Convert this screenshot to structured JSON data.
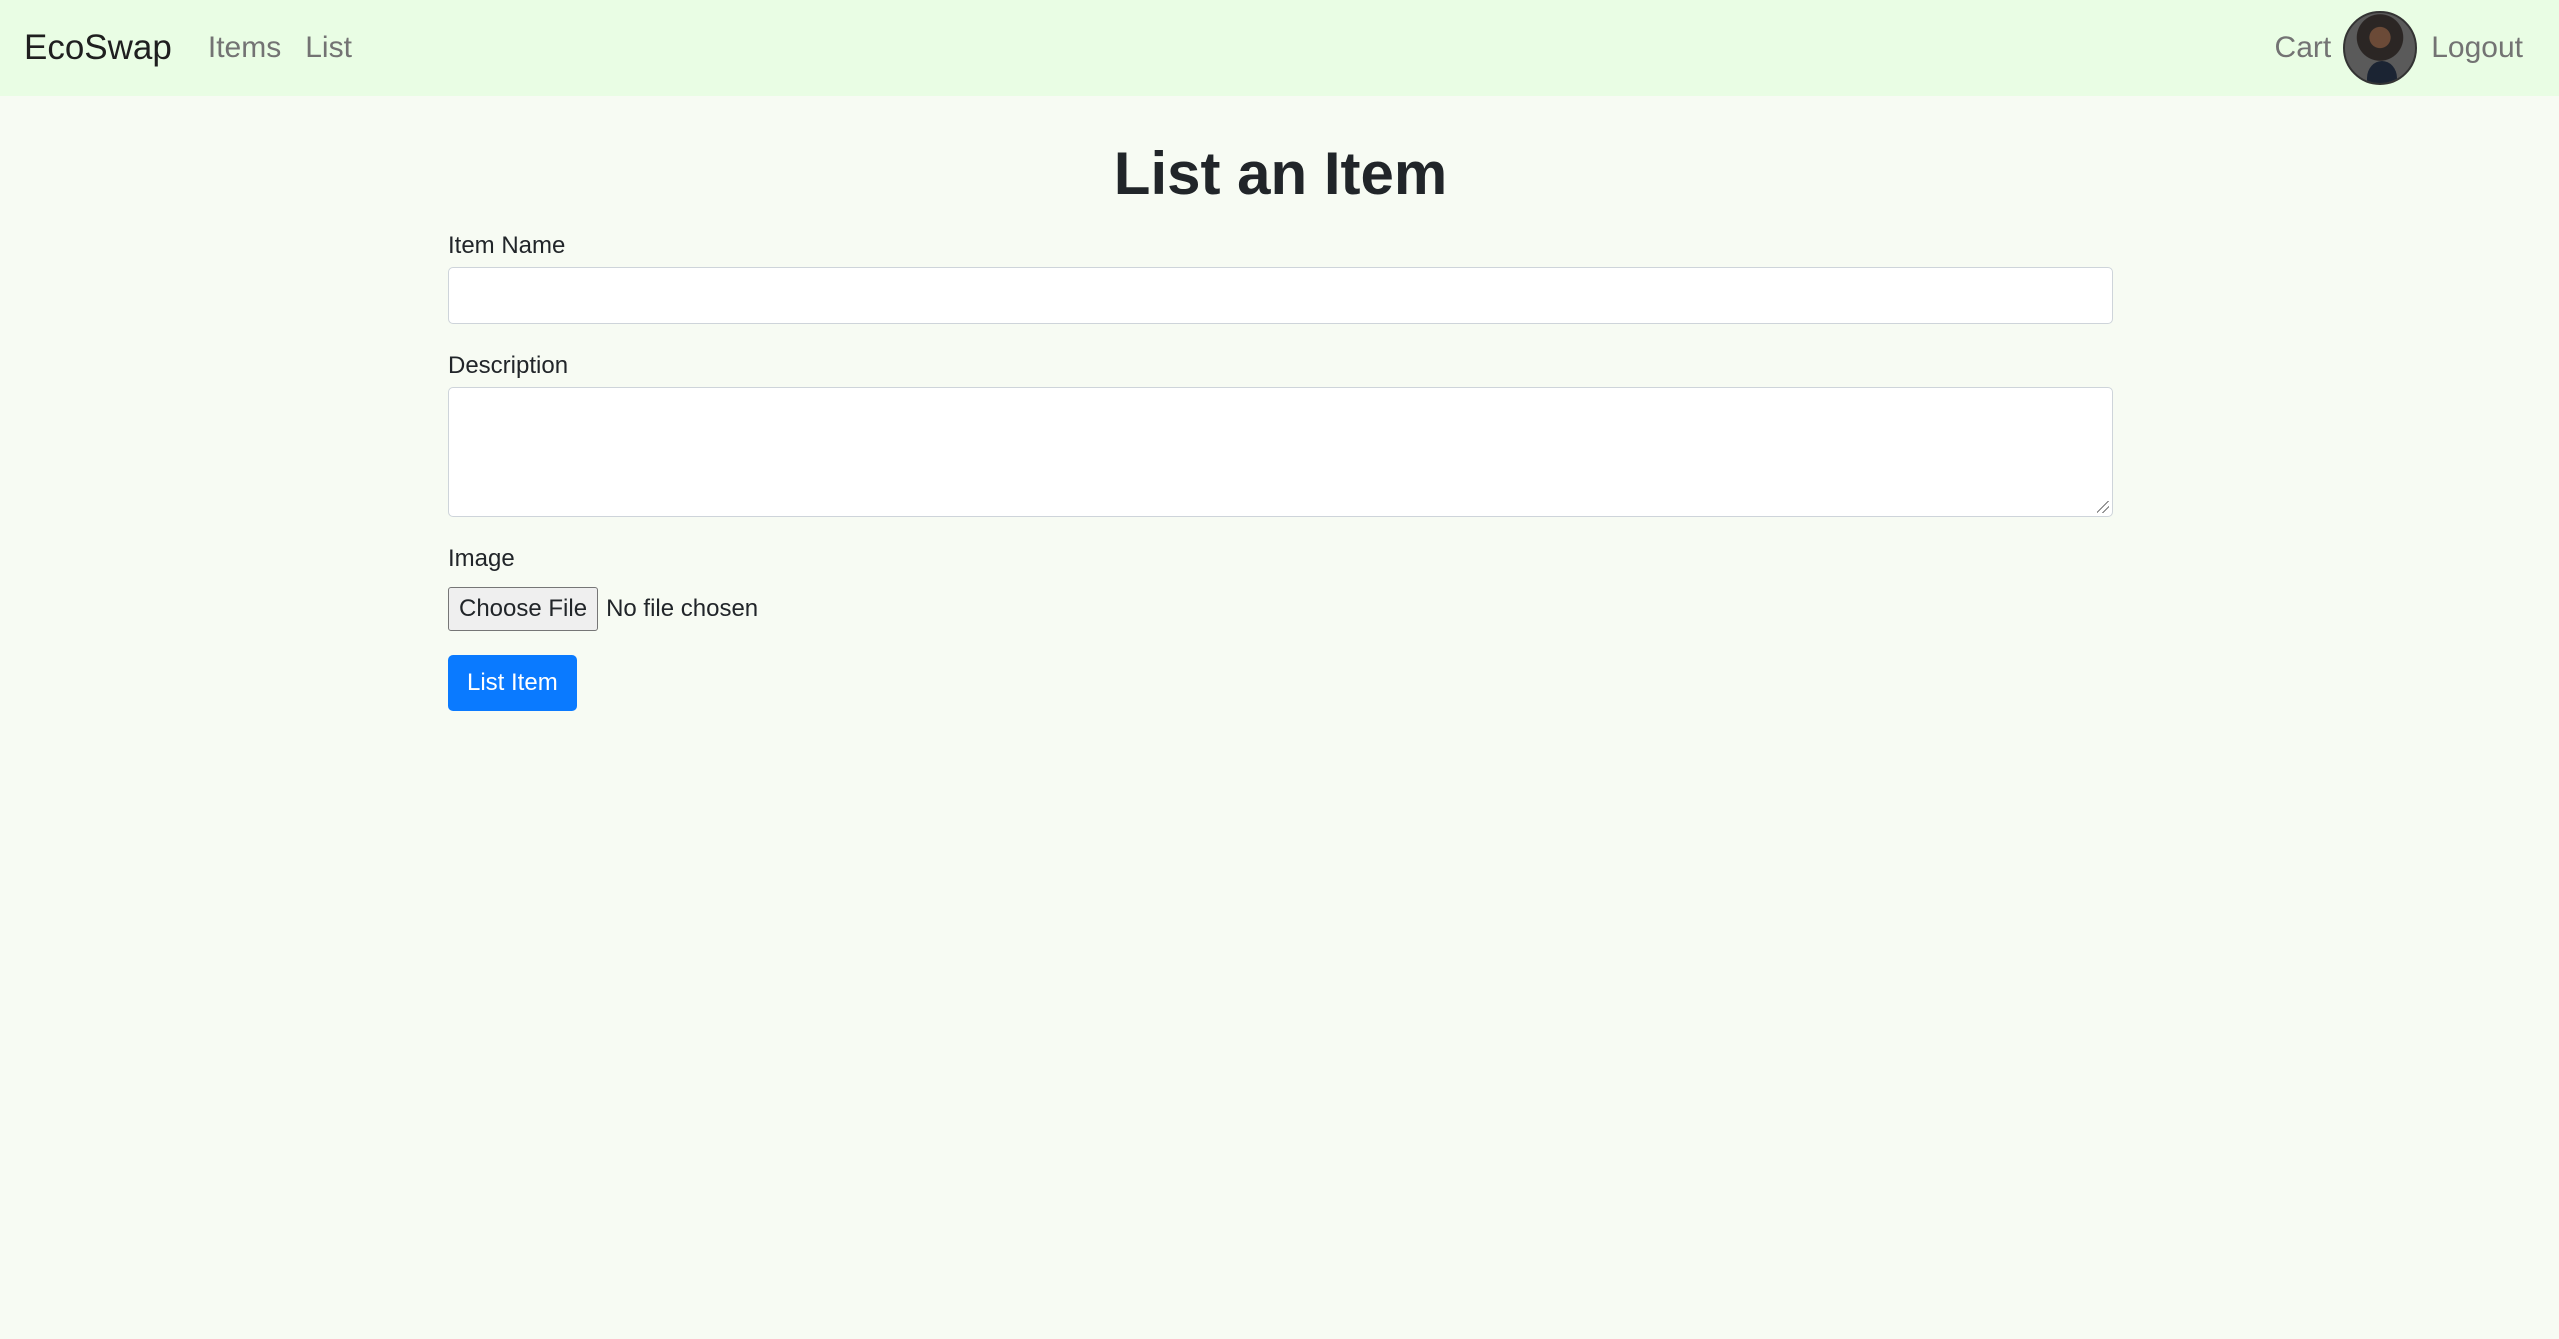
{
  "nav": {
    "brand": "EcoSwap",
    "links": [
      "Items",
      "List"
    ],
    "cart": "Cart",
    "logout": "Logout"
  },
  "form": {
    "title": "List an Item",
    "item_name_label": "Item Name",
    "item_name_value": "",
    "description_label": "Description",
    "description_value": "",
    "image_label": "Image",
    "choose_file_label": "Choose File",
    "file_status": "No file chosen",
    "submit_label": "List Item"
  },
  "colors": {
    "navbar_bg": "#e9fde4",
    "page_bg": "#f7fbf3",
    "primary_button": "#0a7aff"
  }
}
